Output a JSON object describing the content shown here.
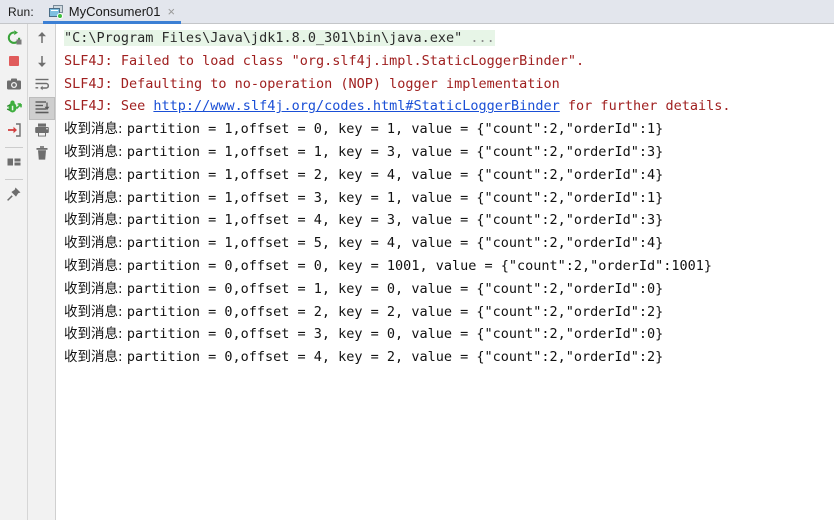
{
  "window": {
    "run_label": "Run:"
  },
  "tab": {
    "title": "MyConsumer01",
    "close_glyph": "×",
    "icon": "run-configuration-icon",
    "active": true,
    "accent_color": "#3b7fd4",
    "status_dot_color": "#3dbf3d"
  },
  "toolbar_left": {
    "items": [
      {
        "name": "rerun-button",
        "label": "Rerun",
        "icon": "rerun-icon"
      },
      {
        "name": "stop-button",
        "label": "Stop",
        "icon": "stop-icon"
      },
      {
        "name": "screenshot-button",
        "label": "Screenshot",
        "icon": "camera-icon"
      },
      {
        "name": "debug-button",
        "label": "Debug",
        "icon": "bug-icon"
      },
      {
        "name": "export-button",
        "label": "Export",
        "icon": "import-arrow-icon"
      },
      {
        "name": "layout-button",
        "label": "Layout",
        "icon": "layout-icon"
      },
      {
        "name": "pin-button",
        "label": "Pin Tab",
        "icon": "pin-icon"
      }
    ]
  },
  "toolbar_right": {
    "items": [
      {
        "name": "up-button",
        "label": "Up the Stack Trace",
        "icon": "arrow-up-icon"
      },
      {
        "name": "down-button",
        "label": "Down the Stack Trace",
        "icon": "arrow-down-icon"
      },
      {
        "name": "soft-wrap-button",
        "label": "Soft-Wrap",
        "icon": "soft-wrap-icon"
      },
      {
        "name": "scroll-to-end-button",
        "label": "Scroll to the End",
        "icon": "scroll-to-end-icon",
        "selected": true
      },
      {
        "name": "print-button",
        "label": "Print",
        "icon": "printer-icon"
      },
      {
        "name": "clear-button",
        "label": "Clear All",
        "icon": "trash-icon"
      }
    ]
  },
  "console": {
    "colors": {
      "command": "#2b2b2b",
      "command_highlight": "#e7f5e7",
      "error": "#a02020",
      "link": "#1a4fd6",
      "message": "#111111"
    },
    "lines": [
      {
        "type": "command",
        "text": "\"C:\\Program Files\\Java\\jdk1.8.0_301\\bin\\java.exe\" ",
        "ellipsis": "..."
      },
      {
        "type": "error",
        "text": "SLF4J: Failed to load class \"org.slf4j.impl.StaticLoggerBinder\"."
      },
      {
        "type": "error",
        "text": "SLF4J: Defaulting to no-operation (NOP) logger implementation"
      },
      {
        "type": "error_link",
        "prefix": "SLF4J: See ",
        "link": "http://www.slf4j.org/codes.html#StaticLoggerBinder",
        "suffix": " for further details."
      },
      {
        "type": "message",
        "cjk": "收到消息: ",
        "text": "partition = 1,offset = 0, key = 1, value = {\"count\":2,\"orderId\":1}"
      },
      {
        "type": "message",
        "cjk": "收到消息: ",
        "text": "partition = 1,offset = 1, key = 3, value = {\"count\":2,\"orderId\":3}"
      },
      {
        "type": "message",
        "cjk": "收到消息: ",
        "text": "partition = 1,offset = 2, key = 4, value = {\"count\":2,\"orderId\":4}"
      },
      {
        "type": "message",
        "cjk": "收到消息: ",
        "text": "partition = 1,offset = 3, key = 1, value = {\"count\":2,\"orderId\":1}"
      },
      {
        "type": "message",
        "cjk": "收到消息: ",
        "text": "partition = 1,offset = 4, key = 3, value = {\"count\":2,\"orderId\":3}"
      },
      {
        "type": "message",
        "cjk": "收到消息: ",
        "text": "partition = 1,offset = 5, key = 4, value = {\"count\":2,\"orderId\":4}"
      },
      {
        "type": "message",
        "cjk": "收到消息: ",
        "text": "partition = 0,offset = 0, key = 1001, value = {\"count\":2,\"orderId\":1001}"
      },
      {
        "type": "message",
        "cjk": "收到消息: ",
        "text": "partition = 0,offset = 1, key = 0, value = {\"count\":2,\"orderId\":0}"
      },
      {
        "type": "message",
        "cjk": "收到消息: ",
        "text": "partition = 0,offset = 2, key = 2, value = {\"count\":2,\"orderId\":2}"
      },
      {
        "type": "message",
        "cjk": "收到消息: ",
        "text": "partition = 0,offset = 3, key = 0, value = {\"count\":2,\"orderId\":0}"
      },
      {
        "type": "message",
        "cjk": "收到消息: ",
        "text": "partition = 0,offset = 4, key = 2, value = {\"count\":2,\"orderId\":2}"
      }
    ]
  }
}
